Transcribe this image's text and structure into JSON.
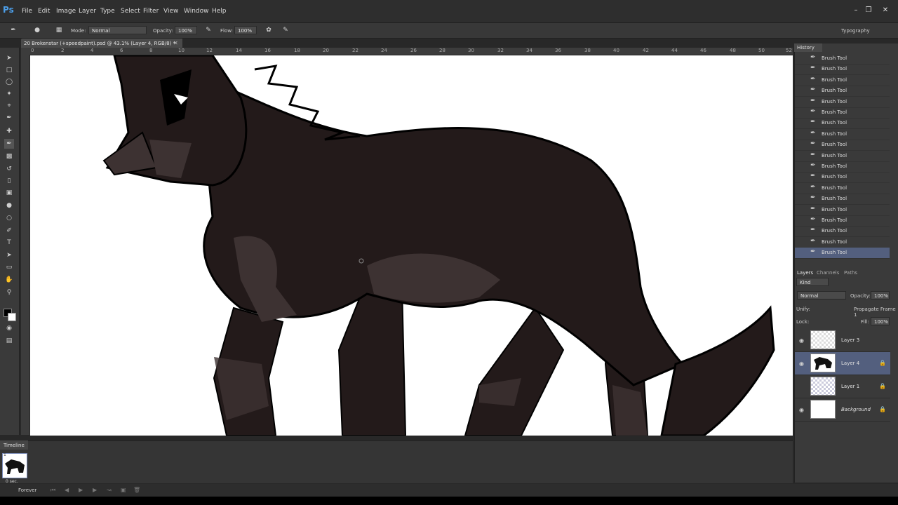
{
  "app": {
    "logo": "Ps"
  },
  "menu": [
    "File",
    "Edit",
    "Image",
    "Layer",
    "Type",
    "Select",
    "Filter",
    "View",
    "Window",
    "Help"
  ],
  "window_buttons": [
    "minimize-icon",
    "restore-icon",
    "close-icon"
  ],
  "options": {
    "mode_label": "Mode:",
    "mode_value": "Normal",
    "opacity_label": "Opacity:",
    "opacity_value": "100%",
    "flow_label": "Flow:",
    "flow_value": "100%",
    "workspace": "Typography"
  },
  "document": {
    "tab_title": "20 Brokenstar (+speedpaint).psd @ 43.1% (Layer 4, RGB/8) *",
    "ruler_ticks": [
      "0",
      "2",
      "4",
      "6",
      "8",
      "10",
      "12",
      "14",
      "16",
      "18",
      "20",
      "22",
      "24",
      "26",
      "28",
      "30",
      "32",
      "34",
      "36",
      "38",
      "40",
      "42",
      "44",
      "46",
      "48",
      "50",
      "52"
    ]
  },
  "history": {
    "tab": "History",
    "items": [
      "Brush Tool",
      "Brush Tool",
      "Brush Tool",
      "Brush Tool",
      "Brush Tool",
      "Brush Tool",
      "Brush Tool",
      "Brush Tool",
      "Brush Tool",
      "Brush Tool",
      "Brush Tool",
      "Brush Tool",
      "Brush Tool",
      "Brush Tool",
      "Brush Tool",
      "Brush Tool",
      "Brush Tool",
      "Brush Tool",
      "Brush Tool"
    ],
    "selected_index": 18
  },
  "layers_panel": {
    "tabs": [
      "Layers",
      "Channels",
      "Paths"
    ],
    "kind_label": "Kind",
    "blend_mode": "Normal",
    "opacity_label": "Opacity:",
    "opacity_value": "100%",
    "unify_label": "Unify:",
    "propagate_label": "Propagate Frame 1",
    "lock_label": "Lock:",
    "fill_label": "Fill:",
    "fill_value": "100%",
    "layers": [
      {
        "name": "Layer 3",
        "visible": true,
        "locked": false,
        "selected": false
      },
      {
        "name": "Layer 4",
        "visible": true,
        "locked": true,
        "selected": true
      },
      {
        "name": "Layer 1",
        "visible": false,
        "locked": true,
        "selected": false
      },
      {
        "name": "Background",
        "visible": true,
        "locked": true,
        "selected": false
      }
    ]
  },
  "timeline": {
    "tab": "Timeline",
    "frame_number": "1",
    "frame_delay": "0 sec.",
    "loop": "Forever"
  },
  "colors": {
    "wolf_body": "#231a1a",
    "wolf_fur_light": "#3d3232",
    "selection": "#535f7e",
    "ui_dark": "#2e2e2e"
  }
}
